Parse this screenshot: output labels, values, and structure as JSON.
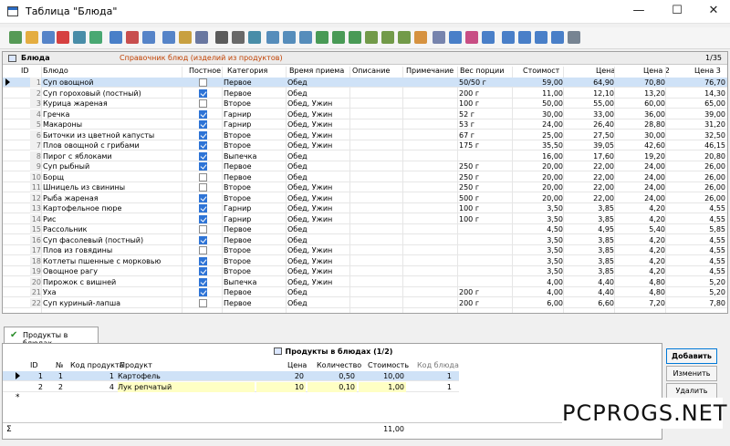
{
  "window": {
    "title": "Таблица \"Блюда\"",
    "minimize": "—",
    "maximize": "☐",
    "close": "✕"
  },
  "toolbar": {
    "icons": [
      "add-icon",
      "edit-icon",
      "copy-icon",
      "delete-icon",
      "save-icon",
      "refresh-icon",
      "filter-icon",
      "filter-clear-icon",
      "filter-edit-icon",
      "filter-2-icon",
      "sort-icon",
      "sql-icon",
      "find-icon",
      "print-icon",
      "preview-icon",
      "export-1-icon",
      "export-2-icon",
      "export-3-icon",
      "export-4-icon",
      "export-5-icon",
      "export-6-icon",
      "export-7-icon",
      "export-8-icon",
      "export-9-icon",
      "chart-icon",
      "music-icon",
      "settings-icon",
      "table-icon",
      "calendar-icon",
      "first-icon",
      "prev-icon",
      "next-icon",
      "last-icon",
      "card-icon"
    ]
  },
  "main": {
    "title": "Блюда",
    "subtitle": "Справочник блюд (изделий из продуктов)",
    "page": "1/35",
    "headers": {
      "id": "ID",
      "name": "Блюдо",
      "lent": "Постное",
      "category": "Категория",
      "time": "Время приема",
      "desc": "Описание",
      "note": "Примечание",
      "portion": "Вес порции",
      "cost": "Стоимость",
      "price": "Цена",
      "price2": "Цена 2",
      "price3": "Цена 3"
    },
    "rows": [
      {
        "id": "1",
        "name": "Суп овощной",
        "lent": false,
        "category": "Первое",
        "time": "Обед",
        "portion": "50/50 г",
        "cost": "59,00",
        "price": "64,90",
        "price2": "70,80",
        "price3": "76,70"
      },
      {
        "id": "2",
        "name": "Суп гороховый (постный)",
        "lent": true,
        "category": "Первое",
        "time": "Обед",
        "portion": "200 г",
        "cost": "11,00",
        "price": "12,10",
        "price2": "13,20",
        "price3": "14,30"
      },
      {
        "id": "3",
        "name": "Курица жареная",
        "lent": false,
        "category": "Второе",
        "time": "Обед, Ужин",
        "portion": "100 г",
        "cost": "50,00",
        "price": "55,00",
        "price2": "60,00",
        "price3": "65,00"
      },
      {
        "id": "4",
        "name": "Гречка",
        "lent": true,
        "category": "Гарнир",
        "time": "Обед, Ужин",
        "portion": "52 г",
        "cost": "30,00",
        "price": "33,00",
        "price2": "36,00",
        "price3": "39,00"
      },
      {
        "id": "5",
        "name": "Макароны",
        "lent": true,
        "category": "Гарнир",
        "time": "Обед, Ужин",
        "portion": "53 г",
        "cost": "24,00",
        "price": "26,40",
        "price2": "28,80",
        "price3": "31,20"
      },
      {
        "id": "6",
        "name": "Биточки из цветной капусты",
        "lent": true,
        "category": "Второе",
        "time": "Обед, Ужин",
        "portion": "67 г",
        "cost": "25,00",
        "price": "27,50",
        "price2": "30,00",
        "price3": "32,50"
      },
      {
        "id": "7",
        "name": "Плов овощной с грибами",
        "lent": true,
        "category": "Второе",
        "time": "Обед, Ужин",
        "portion": "175 г",
        "cost": "35,50",
        "price": "39,05",
        "price2": "42,60",
        "price3": "46,15"
      },
      {
        "id": "8",
        "name": "Пирог с яблоками",
        "lent": true,
        "category": "Выпечка",
        "time": "Обед",
        "portion": "",
        "cost": "16,00",
        "price": "17,60",
        "price2": "19,20",
        "price3": "20,80"
      },
      {
        "id": "9",
        "name": "Суп рыбный",
        "lent": true,
        "category": "Первое",
        "time": "Обед",
        "portion": "250 г",
        "cost": "20,00",
        "price": "22,00",
        "price2": "24,00",
        "price3": "26,00"
      },
      {
        "id": "10",
        "name": "Борщ",
        "lent": false,
        "category": "Первое",
        "time": "Обед",
        "portion": "250 г",
        "cost": "20,00",
        "price": "22,00",
        "price2": "24,00",
        "price3": "26,00"
      },
      {
        "id": "11",
        "name": "Шницель из свинины",
        "lent": false,
        "category": "Второе",
        "time": "Обед, Ужин",
        "portion": "250 г",
        "cost": "20,00",
        "price": "22,00",
        "price2": "24,00",
        "price3": "26,00"
      },
      {
        "id": "12",
        "name": "Рыба жареная",
        "lent": true,
        "category": "Второе",
        "time": "Обед, Ужин",
        "portion": "500 г",
        "cost": "20,00",
        "price": "22,00",
        "price2": "24,00",
        "price3": "26,00"
      },
      {
        "id": "13",
        "name": "Картофельное пюре",
        "lent": true,
        "category": "Гарнир",
        "time": "Обед, Ужин",
        "portion": "100 г",
        "cost": "3,50",
        "price": "3,85",
        "price2": "4,20",
        "price3": "4,55"
      },
      {
        "id": "14",
        "name": "Рис",
        "lent": true,
        "category": "Гарнир",
        "time": "Обед, Ужин",
        "portion": "100 г",
        "cost": "3,50",
        "price": "3,85",
        "price2": "4,20",
        "price3": "4,55"
      },
      {
        "id": "15",
        "name": "Рассольник",
        "lent": false,
        "category": "Первое",
        "time": "Обед",
        "portion": "",
        "cost": "4,50",
        "price": "4,95",
        "price2": "5,40",
        "price3": "5,85"
      },
      {
        "id": "16",
        "name": "Суп фасолевый (постный)",
        "lent": true,
        "category": "Первое",
        "time": "Обед",
        "portion": "",
        "cost": "3,50",
        "price": "3,85",
        "price2": "4,20",
        "price3": "4,55"
      },
      {
        "id": "17",
        "name": "Плов из говядины",
        "lent": false,
        "category": "Второе",
        "time": "Обед, Ужин",
        "portion": "",
        "cost": "3,50",
        "price": "3,85",
        "price2": "4,20",
        "price3": "4,55"
      },
      {
        "id": "18",
        "name": "Котлеты пшенные с морковью",
        "lent": true,
        "category": "Второе",
        "time": "Обед, Ужин",
        "portion": "",
        "cost": "3,50",
        "price": "3,85",
        "price2": "4,20",
        "price3": "4,55"
      },
      {
        "id": "19",
        "name": "Овощное рагу",
        "lent": true,
        "category": "Второе",
        "time": "Обед, Ужин",
        "portion": "",
        "cost": "3,50",
        "price": "3,85",
        "price2": "4,20",
        "price3": "4,55"
      },
      {
        "id": "20",
        "name": "Пирожок с вишней",
        "lent": true,
        "category": "Выпечка",
        "time": "Обед, Ужин",
        "portion": "",
        "cost": "4,00",
        "price": "4,40",
        "price2": "4,80",
        "price3": "5,20"
      },
      {
        "id": "21",
        "name": "Уха",
        "lent": true,
        "category": "Первое",
        "time": "Обед",
        "portion": "200 г",
        "cost": "4,00",
        "price": "4,40",
        "price2": "4,80",
        "price3": "5,20"
      },
      {
        "id": "22",
        "name": "Суп куриный-лапша",
        "lent": false,
        "category": "Первое",
        "time": "Обед",
        "portion": "200 г",
        "cost": "6,00",
        "price": "6,60",
        "price2": "7,20",
        "price3": "7,80"
      }
    ]
  },
  "tab": {
    "label": "Продукты в блюдах"
  },
  "sub": {
    "title": "Продукты в блюдах (1/2)",
    "headers": {
      "id": "ID",
      "n": "№",
      "code": "Код продукта",
      "product": "Продукт",
      "price": "Цена",
      "qty": "Количество",
      "cost": "Стоимость",
      "dish": "Код блюда"
    },
    "rows": [
      {
        "id": "1",
        "n": "1",
        "code": "1",
        "product": "Картофель",
        "price": "20",
        "qty": "0,50",
        "cost": "10,00",
        "dish": "1"
      },
      {
        "id": "2",
        "n": "2",
        "code": "4",
        "product": "Лук репчатый",
        "price": "10",
        "qty": "0,10",
        "cost": "1,00",
        "dish": "1"
      }
    ],
    "sum_label": "Σ",
    "sum": "11,00"
  },
  "buttons": {
    "add": "Добавить",
    "edit": "Изменить",
    "delete": "Удалить"
  },
  "watermark": "PCPROGS.NET"
}
